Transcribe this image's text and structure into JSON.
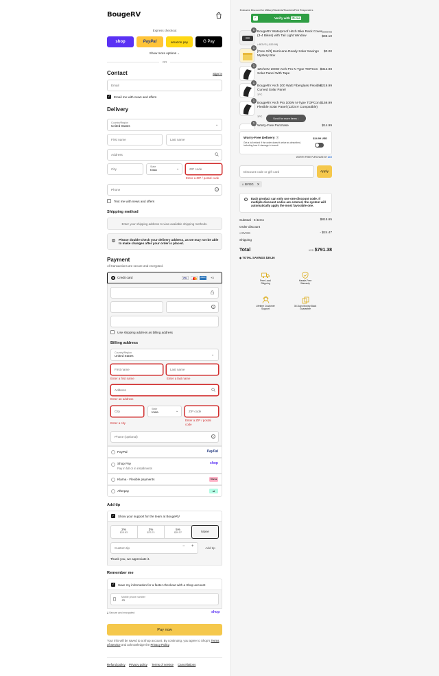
{
  "brand": {
    "logo": "BougeRV",
    "accent": "#f5c400"
  },
  "express": {
    "title": "Express checkout",
    "buttons": [
      "shop",
      "PayPal",
      "amazon pay",
      "G Pay"
    ],
    "more": "Show more options",
    "or": "OR"
  },
  "contact": {
    "title": "Contact",
    "sign_in": "Sign in",
    "email_placeholder": "Email",
    "newsletter": "Email me with news and offers"
  },
  "delivery": {
    "title": "Delivery",
    "country_label": "Country/Region",
    "country_value": "United States",
    "first_name": "First name",
    "last_name": "Last name",
    "address": "Address",
    "city": "City",
    "state_label": "State",
    "state_value": "Iowa",
    "zip": "ZIP code",
    "zip_error": "Enter a ZIP / postal code",
    "phone": "Phone",
    "text_me": "Text me with news and offers"
  },
  "shipping": {
    "title": "Shipping method",
    "placeholder": "Enter your shipping address to view available shipping methods.",
    "notice": "Please double-check your delivery address, as we may not be able to make changes after your order is placed."
  },
  "payment": {
    "title": "Payment",
    "subtitle": "All transactions are secure and encrypted.",
    "credit_card": "Credit card",
    "card_brands": [
      "VISA",
      "MC",
      "AMEX",
      "+3"
    ],
    "use_shipping": "Use shipping address as billing address",
    "billing_title": "Billing address",
    "country_label": "Country/Region",
    "country_value": "United States",
    "first_name": "First name",
    "first_name_error": "Enter a first name",
    "last_name": "Last name",
    "last_name_error": "Enter a last name",
    "address": "Address",
    "address_error": "Enter an address",
    "city": "City",
    "city_error": "Enter a city",
    "state_label": "State",
    "state_value": "Iowa",
    "zip": "ZIP code",
    "zip_error": "Enter a ZIP / postal code",
    "phone": "Phone (optional)",
    "methods": [
      {
        "label": "PayPal",
        "sub": "",
        "logo": "PayPal"
      },
      {
        "label": "Shop Pay",
        "sub": "Pay in full or in installments",
        "logo": "shop"
      },
      {
        "label": "Klarna - Flexible payments",
        "sub": "",
        "logo": "Klarna"
      },
      {
        "label": "Afterpay",
        "sub": "",
        "logo": "afterpay"
      }
    ]
  },
  "tip": {
    "title": "Add tip",
    "support": "Show your support for the team at BougeRV",
    "options": [
      {
        "pct": "2%",
        "amt": "$15.83"
      },
      {
        "pct": "3%",
        "amt": "$23.74"
      },
      {
        "pct": "5%",
        "amt": "$39.57"
      },
      {
        "pct": "None",
        "amt": ""
      }
    ],
    "custom": "Custom tip",
    "add": "Add tip",
    "thanks": "Thank you, we appreciate it."
  },
  "remember": {
    "title": "Remember me",
    "save": "Save my information for a faster checkout with a Shop account",
    "mobile_label": "Mobile phone number",
    "mobile_value": "+1",
    "secure": "Secure and encrypted",
    "shop": "shop"
  },
  "pay_now": "Pay now",
  "legal": {
    "pre": "Your info will be saved to a Shop account. By continuing, you agree to Shop's",
    "terms": "Terms of Service",
    "mid": "and acknowledge the",
    "privacy": "Privacy Policy",
    "end": "."
  },
  "footer_links": [
    "Refund policy",
    "Privacy policy",
    "Terms of service",
    "Cancellations"
  ],
  "summary": {
    "discount_banner": "Exclusive Discount for Military/Students/Teachers/First Responders",
    "verify": "Verify with",
    "verify_brand": "ID.me",
    "items": [
      {
        "qty": "1",
        "name": "BougeRV Waterproof Hitch Bike Rack Cover (3-4 Bikes) with Tail Light Window",
        "sub": "BGVG (-$15.98)",
        "price_old": "$159.98",
        "price": "$98.10"
      },
      {
        "qty": "1",
        "name": "[Free Gift] Hurricane-Ready Solar Savings Mystery Box",
        "sub": "",
        "price_old": "",
        "price": "$0.00"
      },
      {
        "qty": "1",
        "name": "12V/24V 200W Arch Pro N Type TOPCon Solar Panel With Tape",
        "sub": "",
        "price_old": "",
        "price": "$312.98"
      },
      {
        "qty": "1",
        "name": "BougeRV Arch 200 Watt Fiberglass Flexible Curved Solar Panel",
        "sub": "1PC",
        "price_old": "",
        "price": "$219.99"
      },
      {
        "qty": "1",
        "name": "BougeRV Arch Pro 100W N-Type TOPCon Flexible Solar Panel (12/24V Compatible)",
        "sub": "1PC",
        "price_old": "",
        "price": "$159.99"
      },
      {
        "qty": "1",
        "name": "Worry-Free Purchase",
        "sub": "",
        "price_old": "",
        "price": "$14.99"
      }
    ],
    "scroll_hint": "Scroll for more items",
    "worry_free": {
      "title": "Worry-Free Delivery",
      "desc": "Get a full refund if the order doesn't arrive as described, including loss & damage in transit",
      "price": "$14.99 USD",
      "note": "WORRY-FREE PURCHASE BY",
      "note_brand": "seel"
    },
    "discount_placeholder": "Discount code or gift card",
    "apply": "Apply",
    "code": "BVGG",
    "info": "Each product can only use one discount code. If multiple discount codes are entered, the system will automatically apply the most favorable one.",
    "subtotal_label": "Subtotal · 6 items",
    "subtotal": "$815.65",
    "order_discount": "Order discount",
    "discount_code": "BVGG",
    "discount_amt": "- $24.47",
    "shipping_label": "Shipping",
    "total_label": "Total",
    "currency": "USD",
    "total": "$791.38",
    "savings_label": "TOTAL SAVINGS",
    "savings": "$35.36",
    "features": [
      {
        "label": "Free Local Shipping",
        "icon": "truck-icon"
      },
      {
        "label": "Hassle-Free Warranty",
        "icon": "shield-icon"
      },
      {
        "label": "Lifetime Customer Support",
        "icon": "support-icon"
      },
      {
        "label": "30-Days Money-Back Guarantee",
        "icon": "money-back-icon"
      }
    ]
  }
}
